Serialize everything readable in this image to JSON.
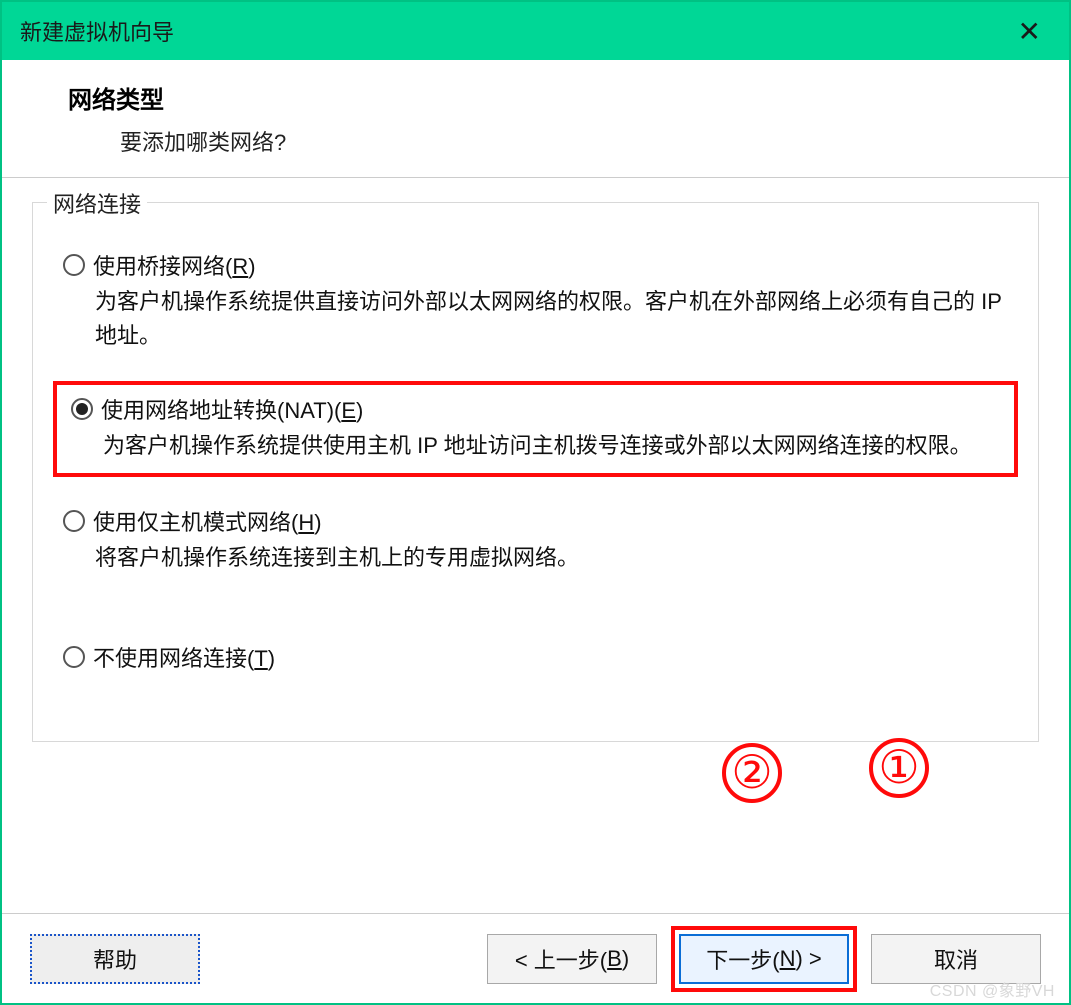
{
  "window": {
    "title": "新建虚拟机向导",
    "close": "✕"
  },
  "header": {
    "title": "网络类型",
    "subtitle": "要添加哪类网络?"
  },
  "fieldset": {
    "legend": "网络连接"
  },
  "options": {
    "bridged": {
      "label_pre": "使用桥接网络(",
      "hotkey": "R",
      "label_post": ")",
      "desc": "为客户机操作系统提供直接访问外部以太网网络的权限。客户机在外部网络上必须有自己的 IP 地址。"
    },
    "nat": {
      "label_pre": "使用网络地址转换(NAT)(",
      "hotkey": "E",
      "label_post": ")",
      "desc": "为客户机操作系统提供使用主机 IP 地址访问主机拨号连接或外部以太网网络连接的权限。"
    },
    "hostonly": {
      "label_pre": "使用仅主机模式网络(",
      "hotkey": "H",
      "label_post": ")",
      "desc": "将客户机操作系统连接到主机上的专用虚拟网络。"
    },
    "none": {
      "label_pre": "不使用网络连接(",
      "hotkey": "T",
      "label_post": ")"
    }
  },
  "buttons": {
    "help": "帮助",
    "back_pre": "< 上一步(",
    "back_hot": "B",
    "back_post": ")",
    "next_pre": "下一步(",
    "next_hot": "N",
    "next_post": ") >",
    "cancel": "取消"
  },
  "annotations": {
    "a1": "①",
    "a2": "②"
  },
  "watermark": "CSDN @象野VH"
}
